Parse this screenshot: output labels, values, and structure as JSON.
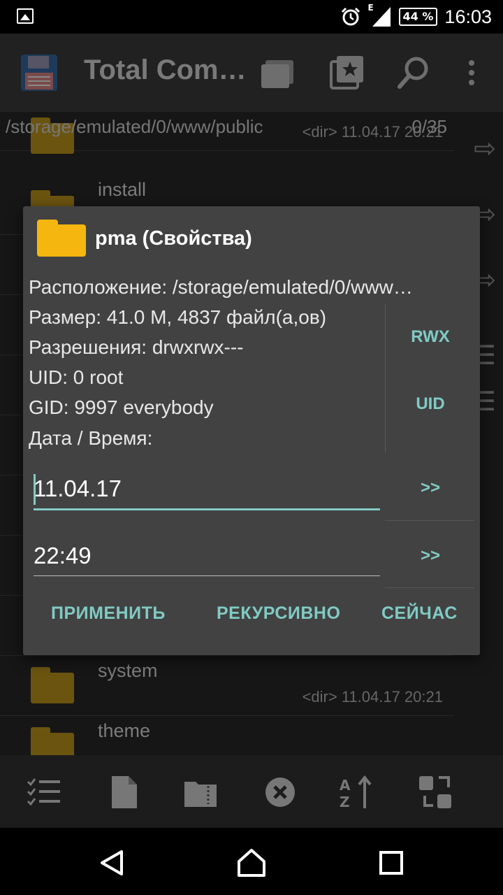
{
  "status_bar": {
    "time": "16:03",
    "battery": "44 %",
    "network_type": "E",
    "icons": [
      "image-notification-icon",
      "alarm-icon",
      "signal-icon",
      "battery-icon"
    ]
  },
  "toolbar": {
    "title": "Total Com…",
    "icons": [
      "save-disk-icon",
      "folders-icon",
      "bookmarks-icon",
      "search-icon",
      "overflow-menu-icon"
    ]
  },
  "file_list": {
    "path": "/storage/emulated/0/www/public",
    "count": "0/35",
    "rows": [
      {
        "name": "",
        "meta": "<dir>  11.04.17  20:21"
      },
      {
        "name": "install",
        "meta": ""
      },
      {
        "name": "system",
        "meta": "<dir>  11.04.17  20:21"
      },
      {
        "name": "theme",
        "meta": ""
      }
    ]
  },
  "dialog": {
    "title": "pma (Свойства)",
    "location": "Расположение: /storage/emulated/0/www…",
    "size": "Размер: 41.0 M, 4837 файл(а,ов)",
    "permissions": "Разрешения: drwxrwx---",
    "uid": "UID: 0 root",
    "gid": "GID: 9997 everybody",
    "datetime_label": "Дата / Время:",
    "rwx_button": "RWX",
    "uid_button": "UID",
    "date_value": "11.04.17",
    "time_value": "22:49",
    "date_more": ">>",
    "time_more": ">>",
    "apply": "ПРИМЕНИТЬ",
    "recursive": "РЕКУРСИВНО",
    "now": "СЕЙЧАС",
    "accent_color": "#80cbc4",
    "folder_color": "#f5b70f"
  },
  "bottom_bar": {
    "icons": [
      "select-list-icon",
      "new-file-icon",
      "zip-folder-icon",
      "close-circle-icon",
      "sort-az-icon",
      "swap-panels-icon"
    ]
  },
  "nav_bar": {
    "icons": [
      "back-icon",
      "home-icon",
      "recents-icon"
    ]
  }
}
